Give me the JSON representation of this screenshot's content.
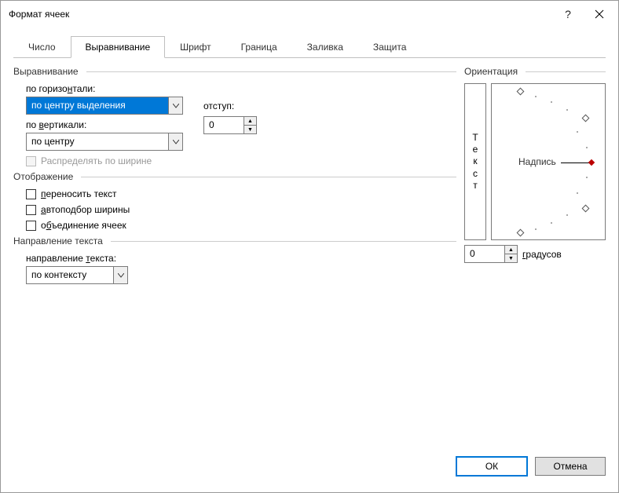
{
  "title": "Формат ячеек",
  "tabs": [
    "Число",
    "Выравнивание",
    "Шрифт",
    "Граница",
    "Заливка",
    "Защита"
  ],
  "active_tab": 1,
  "alignment": {
    "group_label": "Выравнивание",
    "horizontal_label": "по горизонтали:",
    "horizontal_hotkey": "н",
    "horizontal_value": "по центру выделения",
    "indent_label": "отступ:",
    "indent_value": "0",
    "vertical_label": "по вертикали:",
    "vertical_hotkey": "в",
    "vertical_value": "по центру",
    "justify_label": "Распределять по ширине"
  },
  "display": {
    "group_label": "Отображение",
    "wrap_label": "переносить текст",
    "wrap_hotkey": "п",
    "autofit_label": "автоподбор ширины",
    "autofit_hotkey": "а",
    "merge_label": "объединение ячеек",
    "merge_hotkey": "б"
  },
  "direction": {
    "group_label": "Направление текста",
    "label": "направление текста:",
    "hotkey": "т",
    "value": "по контексту"
  },
  "orientation": {
    "group_label": "Ориентация",
    "vertical_text": "Текст",
    "needle_label": "Надпись",
    "degrees_value": "0",
    "degrees_label": "градусов",
    "degrees_hotkey": "г"
  },
  "buttons": {
    "ok": "ОК",
    "cancel": "Отмена"
  }
}
